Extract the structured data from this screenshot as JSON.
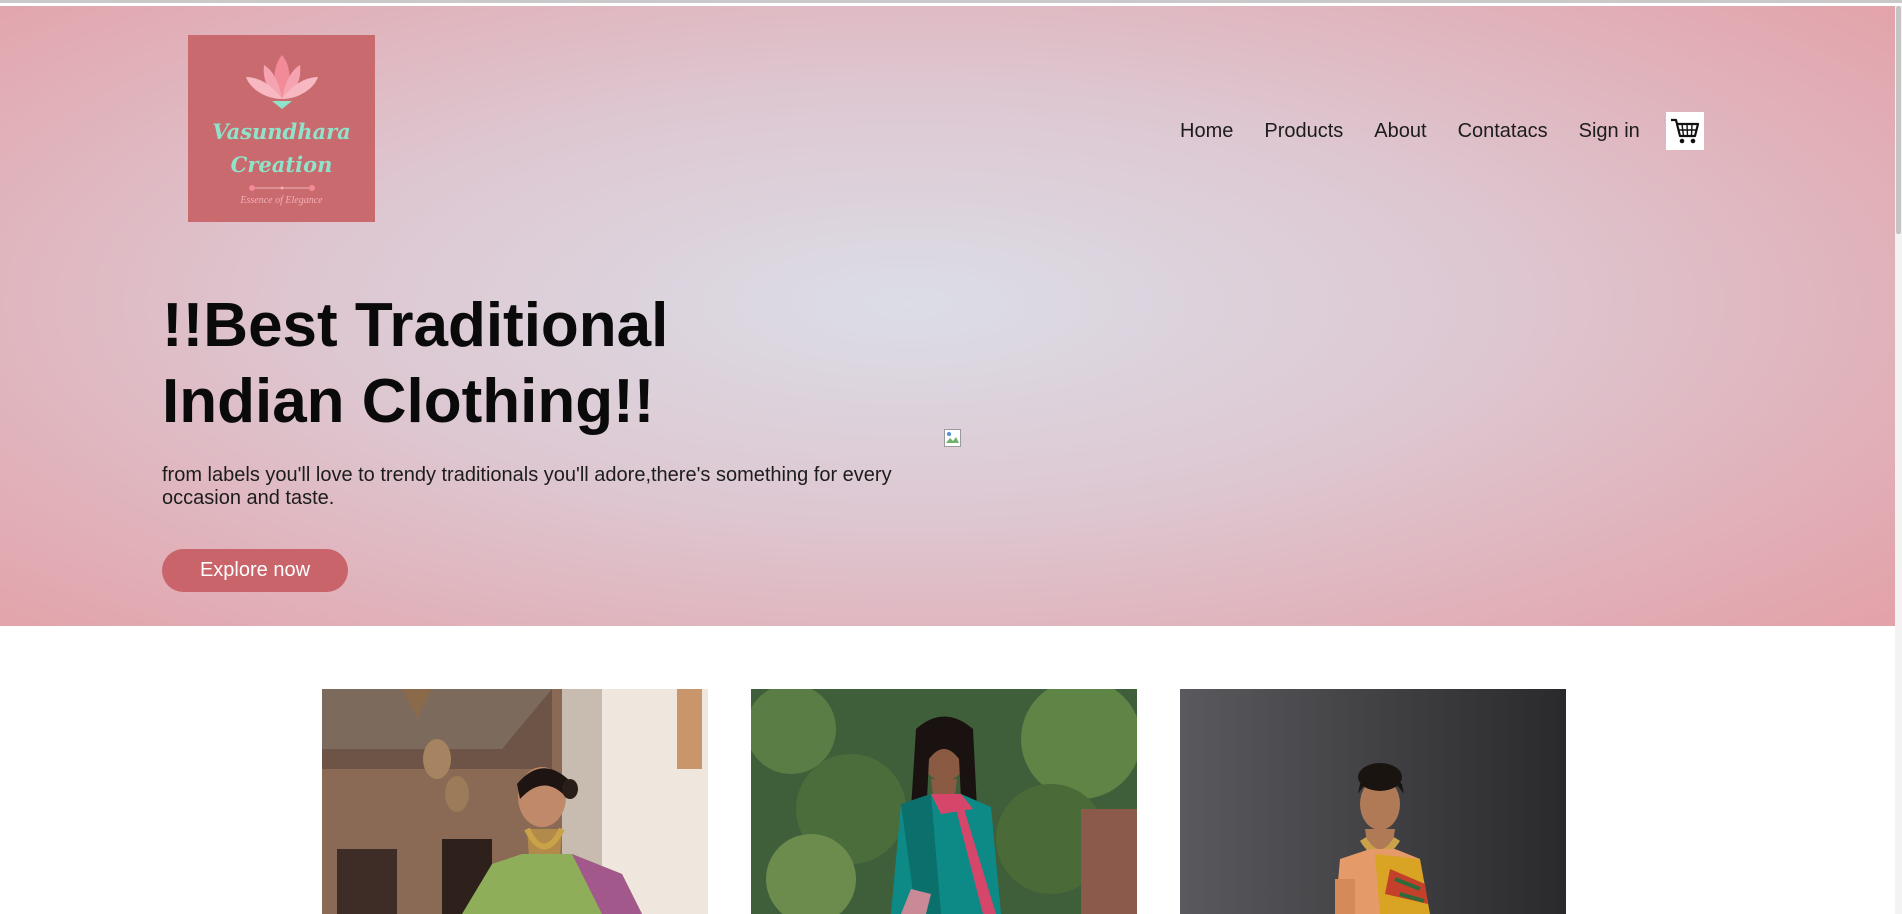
{
  "brand": {
    "name_line1": "Vasundhara",
    "name_line2": "Creation",
    "tagline": "Essence of Elegance",
    "logo_icon": "lotus-icon"
  },
  "nav": {
    "items": [
      "Home",
      "Products",
      "About",
      "Contatacs",
      "Sign in"
    ],
    "cart_icon": "shopping-cart-icon"
  },
  "hero": {
    "headline_line1": "!!Best Traditional",
    "headline_line2": "Indian Clothing!!",
    "subtext": "from labels you'll love to trendy traditionals you'll adore,there's something for every occasion and taste.",
    "cta_label": "Explore now",
    "broken_image_icon": "broken-image-icon"
  },
  "products": {
    "cards": [
      {
        "name": "product-image-1",
        "subject": "woman in green saree with gold jewellery"
      },
      {
        "name": "product-image-2",
        "subject": "woman in teal saree with pink border"
      },
      {
        "name": "product-image-3",
        "subject": "woman in yellow paithani saree"
      }
    ]
  },
  "colors": {
    "hero_center": "#dcdde6",
    "hero_edge": "#e59499",
    "logo_bg": "#c96a6e",
    "brand_text": "#8fe3cb",
    "cta_bg": "#c9646a"
  }
}
